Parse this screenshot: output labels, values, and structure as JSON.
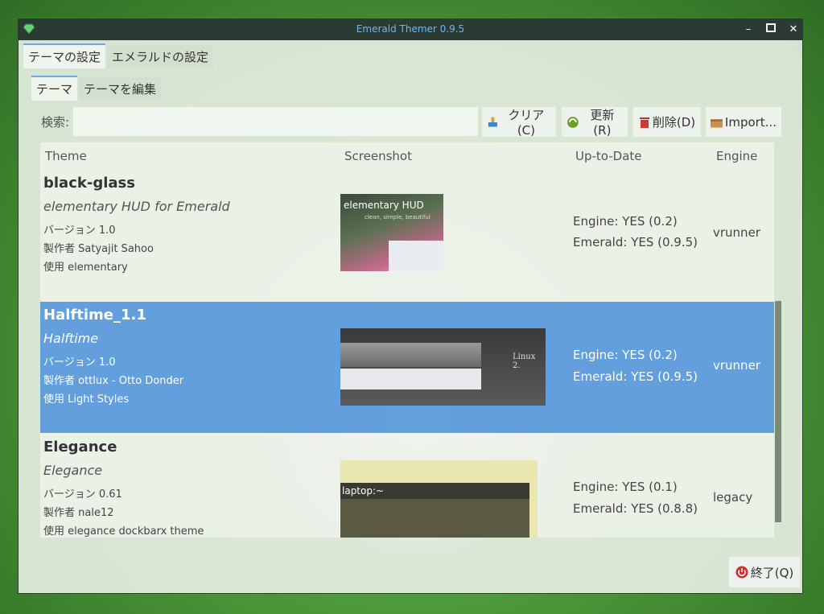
{
  "window": {
    "title": "Emerald Themer 0.9.5"
  },
  "tabs_top": [
    "テーマの設定",
    "エメラルドの設定"
  ],
  "tabs_sub": [
    "テーマ",
    "テーマを編集"
  ],
  "search": {
    "label": "検索:",
    "value": ""
  },
  "buttons": {
    "clear": "クリア(C)",
    "refresh": "更新(R)",
    "delete": "削除(D)",
    "import": "Import..."
  },
  "columns": [
    "Theme",
    "Screenshot",
    "Up-to-Date",
    "Engine"
  ],
  "themes": [
    {
      "name": "black-glass",
      "description": "elementary HUD for Emerald",
      "version": "バージョン 1.0",
      "author": "製作者 Satyajit Sahoo",
      "use": "使用 elementary",
      "engine_status": "Engine: YES (0.2)",
      "emerald_status": "Emerald: YES (0.9.5)",
      "engine": "vrunner",
      "shot_title": "elementary HUD",
      "shot_sub": "clean, simple, beautiful"
    },
    {
      "name": "Halftime_1.1",
      "description": "Halftime",
      "version": "バージョン 1.0",
      "author": "製作者 ottlux - Otto Donder",
      "use": "使用 Light Styles",
      "engine_status": "Engine: YES (0.2)",
      "emerald_status": "Emerald: YES (0.9.5)",
      "engine": "vrunner",
      "shot_text": "Linux 2."
    },
    {
      "name": "Elegance",
      "description": "Elegance",
      "version": "バージョン 0.61",
      "author": "製作者 nale12",
      "use": "使用 elegance dockbarx theme",
      "engine_status": "Engine: YES (0.1)",
      "emerald_status": "Emerald: YES (0.8.8)",
      "engine": "legacy",
      "shot_text": "laptop:~"
    }
  ],
  "quit": "終了(Q)",
  "colors": {
    "selection": "#4a90d9",
    "titlebar": "#2b3a34"
  }
}
